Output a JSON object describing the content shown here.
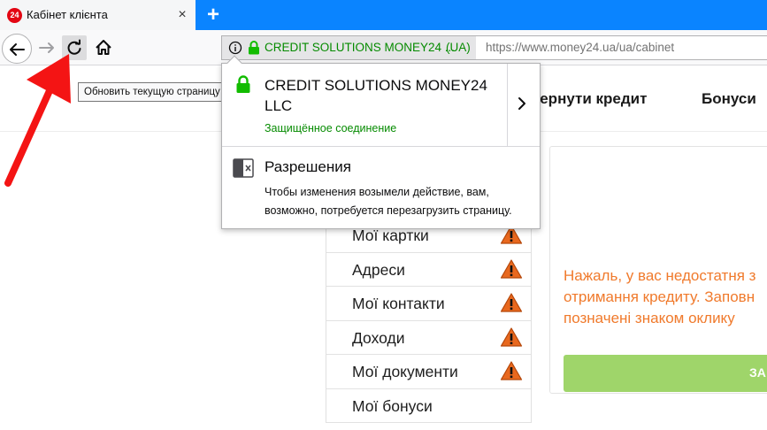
{
  "browser": {
    "tab": {
      "title": "Кабінет клієнта",
      "favicon_text": "24",
      "close_glyph": "×"
    },
    "new_tab_glyph": "+",
    "urlbar": {
      "identity_label": "CREDIT SOLUTIONS MONEY24 ...",
      "identity_country": "(UA)",
      "url": "https://www.money24.ua/ua/cabinet"
    },
    "reload_tooltip": "Обновить текущую страницу (Ctrl+R)",
    "icons": [
      "back-arrow-icon",
      "forward-arrow-icon",
      "reload-icon",
      "home-icon",
      "info-icon",
      "lock-icon"
    ],
    "colors": {
      "tabstrip": "#0a84ff",
      "secure_green": "#058b00"
    }
  },
  "identity_popup": {
    "organization": "CREDIT SOLUTIONS MONEY24 LLC",
    "connection_status": "Защищённое соединение",
    "permissions_title": "Разрешения",
    "permissions_description": "Чтобы изменения возымели действие, вам, возможно, потребуется перезагрузить страницу."
  },
  "site": {
    "nav": {
      "repay_credit": "вернути кредит",
      "bonuses": "Бонуси"
    },
    "profile_menu": [
      {
        "label": "Мої картки",
        "warning": true
      },
      {
        "label": "Адреси",
        "warning": true
      },
      {
        "label": "Мої контакти",
        "warning": true
      },
      {
        "label": "Доходи",
        "warning": true
      },
      {
        "label": "Мої документи",
        "warning": true
      },
      {
        "label": "Мої бонуси",
        "warning": false
      }
    ],
    "notice": {
      "line1": "Нажаль, у вас недостатня з",
      "line2": "отримання кредиту. Заповн",
      "line3": "позначені знаком оклику",
      "button_label": "ЗА"
    },
    "colors": {
      "notice_text": "#f07a2c",
      "button": "#9fd56a",
      "warning": "#e8681e"
    }
  }
}
